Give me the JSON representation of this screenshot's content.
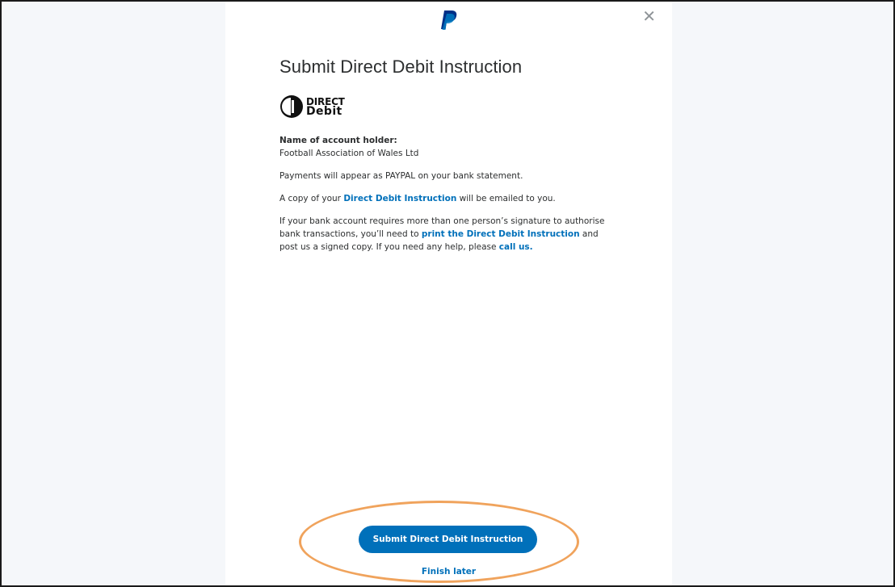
{
  "modal": {
    "title": "Submit Direct Debit Instruction",
    "close_icon": "close-icon",
    "brand_icon": "paypal-logo"
  },
  "direct_debit_logo": {
    "line1": "DIRECT",
    "line2": "Debit"
  },
  "account_holder": {
    "label": "Name of account holder:",
    "name": "Football Association of Wales Ltd"
  },
  "paragraphs": {
    "statement": "Payments will appear as PAYPAL on your bank statement.",
    "copy_prefix": "A copy of your ",
    "copy_link": "Direct Debit Instruction",
    "copy_suffix": " will be emailed to you.",
    "sig_part1": "If your bank account requires more than one person’s signature to authorise bank transactions, you’ll need to ",
    "sig_link": "print the Direct Debit Instruction",
    "sig_part2": " and post us a signed copy. If you need any help, please ",
    "sig_link2": "call us.",
    "sig_end": ""
  },
  "actions": {
    "submit_label": "Submit Direct Debit Instruction",
    "finish_later_label": "Finish later"
  },
  "colors": {
    "link_blue": "#0070ba",
    "highlight_orange": "#f0a35c",
    "background": "#f5f7fa"
  }
}
